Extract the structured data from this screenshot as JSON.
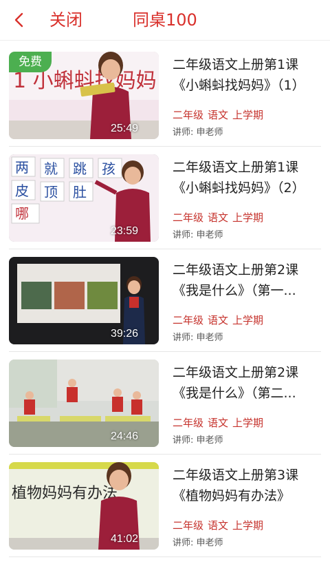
{
  "header": {
    "back_icon": "chevron-left-icon",
    "close_label": "关闭",
    "title": "同桌100",
    "accent": "#d9302b"
  },
  "lessons": [
    {
      "title_line1": "二年级语文上册第1课",
      "title_line2": "《小蝌蚪找妈妈》（1）",
      "tag_grade": "二年级",
      "tag_subject": "语文",
      "tag_term": "上学期",
      "lecturer": "讲师: 申老师",
      "duration": "25:49",
      "badge": "免费",
      "thumb_text": "1 小蝌蚪找妈妈"
    },
    {
      "title_line1": "二年级语文上册第1课",
      "title_line2": "《小蝌蚪找妈妈》（2）",
      "tag_grade": "二年级",
      "tag_subject": "语文",
      "tag_term": "上学期",
      "lecturer": "讲师: 申老师",
      "duration": "23:59",
      "thumb_chars": [
        "两",
        "就",
        "跳",
        "孩",
        "皮",
        "顶",
        "肚",
        "哪"
      ]
    },
    {
      "title_line1": "二年级语文上册第2课",
      "title_line2": "《我是什么》（第一...",
      "tag_grade": "二年级",
      "tag_subject": "语文",
      "tag_term": "上学期",
      "lecturer": "讲师: 申老师",
      "duration": "39:26"
    },
    {
      "title_line1": "二年级语文上册第2课",
      "title_line2": "《我是什么》（第二...",
      "tag_grade": "二年级",
      "tag_subject": "语文",
      "tag_term": "上学期",
      "lecturer": "讲师: 申老师",
      "duration": "24:46"
    },
    {
      "title_line1": "二年级语文上册第3课",
      "title_line2": "《植物妈妈有办法》",
      "tag_grade": "二年级",
      "tag_subject": "语文",
      "tag_term": "上学期",
      "lecturer": "讲师: 申老师",
      "duration": "41:02",
      "thumb_text": "植物妈妈有办法"
    }
  ],
  "colors": {
    "tag": "#c6332d",
    "free_badge": "#4caf50"
  }
}
